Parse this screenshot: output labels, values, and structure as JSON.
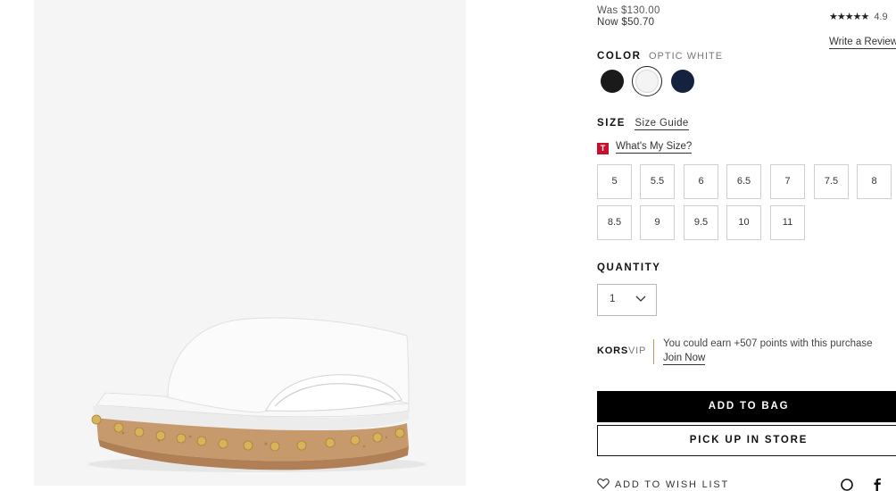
{
  "price": {
    "was": "Was $130.00",
    "now": "Now $50.70"
  },
  "rating": {
    "stars": "★★★★★",
    "score": "4.9"
  },
  "review_link": "Write a Review",
  "color": {
    "label": "COLOR",
    "selected": "OPTIC WHITE",
    "swatches": [
      {
        "name": "black",
        "hex": "#1a1a1a"
      },
      {
        "name": "optic-white",
        "hex": "#f4f4f4"
      },
      {
        "name": "navy",
        "hex": "#14223d"
      }
    ]
  },
  "size": {
    "label": "SIZE",
    "guide": "Size Guide",
    "whats_my_size": "What's My Size?",
    "tcon_letter": "T",
    "options": [
      "5",
      "5.5",
      "6",
      "6.5",
      "7",
      "7.5",
      "8",
      "8.5",
      "9",
      "9.5",
      "10",
      "11"
    ]
  },
  "quantity": {
    "label": "QUANTITY",
    "value": "1"
  },
  "vip": {
    "brand": "KORS",
    "suffix": "VIP",
    "message": "You could earn +507 points with this purchase",
    "cta": "Join Now"
  },
  "buttons": {
    "add_to_bag": "ADD TO BAG",
    "pick_up": "PICK UP IN STORE"
  },
  "wishlist": "ADD TO WISH LIST",
  "colors": {
    "accent_gold": "#b9975b",
    "tcon_red": "#c8102e",
    "image_bg": "#f5f5f5"
  }
}
